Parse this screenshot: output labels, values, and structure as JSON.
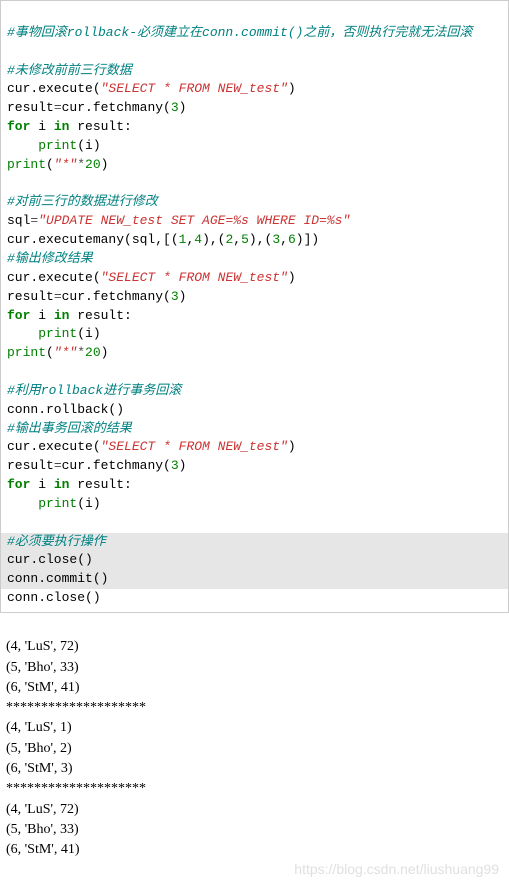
{
  "code": {
    "c1": "#事物回滚rollback-必须建立在conn.commit()之前，否则执行完就无法回滚",
    "c2": "#未修改前前三行数据",
    "l3a": "cur.execute(",
    "l3s": "\"SELECT * FROM NEW_test\"",
    "l3b": ")",
    "l4a": "result",
    "l4eq": "=",
    "l4b": "cur.fetchmany(",
    "l4n": "3",
    "l4c": ")",
    "l5a": "for",
    "l5b": " i ",
    "l5c": "in",
    "l5d": " result:",
    "l6a": "    ",
    "l6b": "print",
    "l6c": "(i)",
    "l7a": "print",
    "l7b": "(",
    "l7s": "\"*\"",
    "l7c": "*",
    "l7n": "20",
    "l7d": ")",
    "c3": "#对前三行的数据进行修改",
    "l9a": "sql",
    "l9eq": "=",
    "l9s": "\"UPDATE NEW_test SET AGE=%s WHERE ID=%s\"",
    "l10a": "cur.executemany(sql,[(",
    "l10n1": "1",
    "l10c1": ",",
    "l10n2": "4",
    "l10c2": "),(",
    "l10n3": "2",
    "l10c3": ",",
    "l10n4": "5",
    "l10c4": "),(",
    "l10n5": "3",
    "l10c5": ",",
    "l10n6": "6",
    "l10c6": ")])",
    "c4": "#输出修改结果",
    "c5": "#利用rollback进行事务回滚",
    "l16": "conn.rollback()",
    "c6": "#输出事务回滚的结果",
    "c7": "#必须要执行操作",
    "l22": "cur.close()",
    "l23": "conn.commit()",
    "l24": "conn.close()"
  },
  "output": {
    "r1": "(4, 'LuS', 72)",
    "r2": "(5, 'Bho', 33)",
    "r3": "(6, 'StM', 41)",
    "sep": "********************",
    "r4": "(4, 'LuS', 1)",
    "r5": "(5, 'Bho', 2)",
    "r6": "(6, 'StM', 3)",
    "r7": "(4, 'LuS', 72)",
    "r8": "(5, 'Bho', 33)",
    "r9": "(6, 'StM', 41)"
  },
  "watermark": "https://blog.csdn.net/liushuang99"
}
